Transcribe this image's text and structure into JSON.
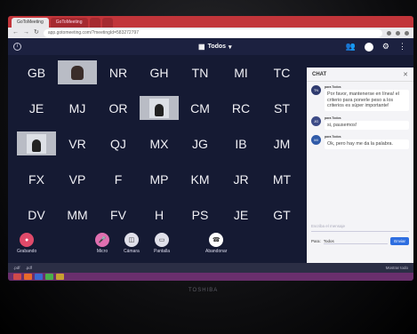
{
  "browser": {
    "tabs": [
      "GoToMeeting",
      "GoToMeeting",
      "",
      ""
    ],
    "url": "app.gotomeeting.com/?meetingId=583272797"
  },
  "meeting": {
    "view_label": "Todos",
    "participants": [
      {
        "initials": "GB"
      },
      {
        "initials": "",
        "photo": true
      },
      {
        "initials": "NR"
      },
      {
        "initials": "GH"
      },
      {
        "initials": "TN"
      },
      {
        "initials": "MI"
      },
      {
        "initials": "TC"
      },
      {
        "initials": "JE"
      },
      {
        "initials": "MJ"
      },
      {
        "initials": "OR"
      },
      {
        "initials": "",
        "photo": true
      },
      {
        "initials": "CM"
      },
      {
        "initials": "RC"
      },
      {
        "initials": "ST"
      },
      {
        "initials": "",
        "photo": true
      },
      {
        "initials": "VR"
      },
      {
        "initials": "QJ"
      },
      {
        "initials": "MX"
      },
      {
        "initials": "JG"
      },
      {
        "initials": "IB"
      },
      {
        "initials": "JM"
      },
      {
        "initials": "FX"
      },
      {
        "initials": "VP"
      },
      {
        "initials": "F"
      },
      {
        "initials": "MP"
      },
      {
        "initials": "KM"
      },
      {
        "initials": "JR"
      },
      {
        "initials": "MT"
      },
      {
        "initials": "DV"
      },
      {
        "initials": "MM"
      },
      {
        "initials": "FV"
      },
      {
        "initials": "H"
      },
      {
        "initials": "PS"
      },
      {
        "initials": "JE"
      },
      {
        "initials": "GT"
      }
    ],
    "controls": {
      "record": "Grabando",
      "mic": "Micro",
      "camera": "Cámara",
      "screen": "Pantalla",
      "leave": "Abandonar"
    }
  },
  "chat": {
    "title": "CHAT",
    "messages": [
      {
        "avatar": "TN",
        "to": "para Todos",
        "text": "Por favor, mantenerse en línea! el criterio para ponerle peso a los criterios es súper importante!"
      },
      {
        "avatar": "JG",
        "to": "para Todos",
        "text": "si, pausemos!"
      },
      {
        "avatar": "MI",
        "to": "para Todos",
        "text": "Ok, pero hay me da la palabra."
      }
    ],
    "input_placeholder": "Escriba el mensaje",
    "recipient_label": "Para:",
    "recipient_value": "Todos",
    "send_label": "Enviar"
  },
  "downloads": {
    "items": [
      ".pdf",
      ".pdf",
      "",
      "",
      ""
    ],
    "show_all": "Mostrar todo"
  },
  "device": {
    "brand": "TOSHIBA"
  },
  "colors": {
    "background": "#151a33",
    "chrome": "#c2353a",
    "record": "#e04a6a",
    "mic": "#e06fb0",
    "leave": "#ffffff",
    "taskbar": "#6a2f6d"
  }
}
